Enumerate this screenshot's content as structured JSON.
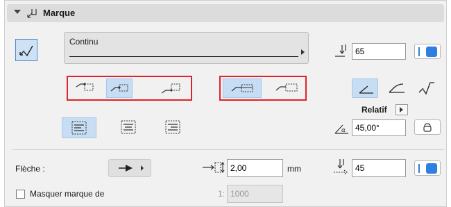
{
  "header": {
    "title": "Marque"
  },
  "line_type": {
    "name": "Continu"
  },
  "marker_size": {
    "value": "65"
  },
  "relatif": {
    "label": "Relatif"
  },
  "angle": {
    "value": "45,00°"
  },
  "arrow": {
    "label": "Flèche :"
  },
  "offset": {
    "value": "2,00",
    "unit": "mm"
  },
  "pen_value": {
    "value": "45"
  },
  "hide_marker": {
    "label": "Masquer marque de",
    "scale_prefix": "1:",
    "scale_value": "1000"
  },
  "colors": {
    "accent": "#2f7fe0",
    "highlight_box": "#e0232a",
    "selected_bg": "#c7ddf3"
  }
}
